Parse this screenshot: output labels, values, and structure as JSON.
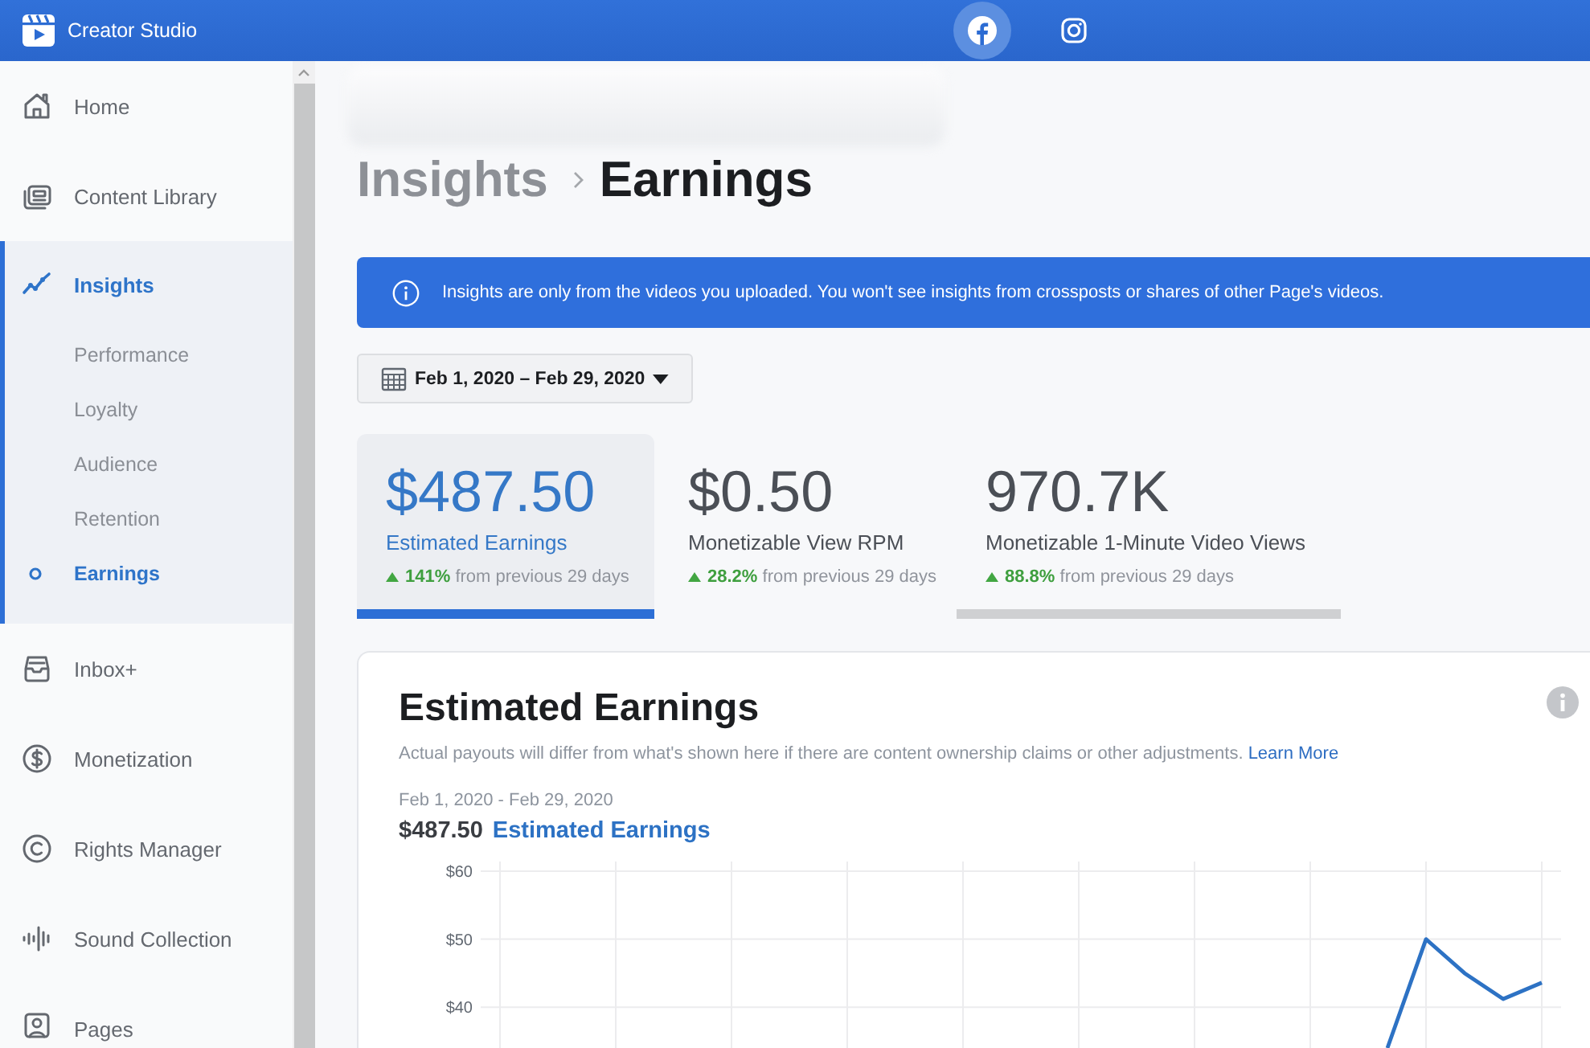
{
  "top_bar": {
    "title": "Creator Studio",
    "platform_tabs": [
      {
        "selected": true
      },
      {
        "selected": false
      }
    ]
  },
  "sidebar": {
    "items": [
      {
        "label": "Home",
        "selected": false
      },
      {
        "label": "Content Library",
        "selected": false
      },
      {
        "label": "Insights",
        "selected": true,
        "expanded": true,
        "children": [
          {
            "label": "Performance",
            "selected": false
          },
          {
            "label": "Loyalty",
            "selected": false
          },
          {
            "label": "Audience",
            "selected": false
          },
          {
            "label": "Retention",
            "selected": false
          },
          {
            "label": "Earnings",
            "selected": true
          }
        ]
      },
      {
        "label": "Inbox+",
        "selected": false
      },
      {
        "label": "Monetization",
        "selected": false
      },
      {
        "label": "Rights Manager",
        "selected": false
      },
      {
        "label": "Sound Collection",
        "selected": false
      },
      {
        "label": "Pages",
        "selected": false
      }
    ]
  },
  "page_header": {
    "blurred": true
  },
  "breadcrumb": [
    "Insights",
    "Earnings"
  ],
  "notice": {
    "text": "Insights are only from the videos you uploaded. You won't see insights from crossposts or shares of other Page's videos."
  },
  "date_picker": {
    "value": "Feb 1, 2020 – Feb 29, 2020"
  },
  "metrics": [
    {
      "value": "$487.50",
      "label": "Estimated Earnings",
      "change": "**141%** from previous 29 days",
      "selected": true,
      "hovered": false
    },
    {
      "value": "$0.50",
      "label": "Monetizable View RPM",
      "change": "**28.2%** from previous 29 days",
      "selected": false,
      "hovered": false
    },
    {
      "value": "970.7K",
      "label": "Monetizable 1-Minute Video Views",
      "change": "**88.8%** from previous 29 days",
      "selected": false,
      "hovered": true
    }
  ],
  "earnings_card": {
    "title": "Estimated Earnings",
    "note": "Actual payouts will differ from what's shown here if there are content ownership claims or other adjustments.",
    "link": "Learn More",
    "date_range": "Feb 1, 2020 - Feb 29, 2020",
    "total": "$487.50",
    "chart_data": {
      "type": "line",
      "grid": true,
      "ylim": [
        34,
        60
      ],
      "yticks": [
        {
          "value": 40,
          "label": "$40"
        },
        {
          "value": 50,
          "label": "$50"
        },
        {
          "value": 60,
          "label": "$60"
        }
      ],
      "series": [
        {
          "name": "Estimated Earnings",
          "color": "#2d72c4",
          "values": [
            null,
            null,
            null,
            null,
            null,
            null,
            null,
            null,
            null,
            null,
            null,
            null,
            null,
            null,
            null,
            null,
            null,
            null,
            null,
            null,
            null,
            null,
            null,
            34,
            50,
            45,
            41.2,
            43.6
          ]
        }
      ]
    }
  }
}
